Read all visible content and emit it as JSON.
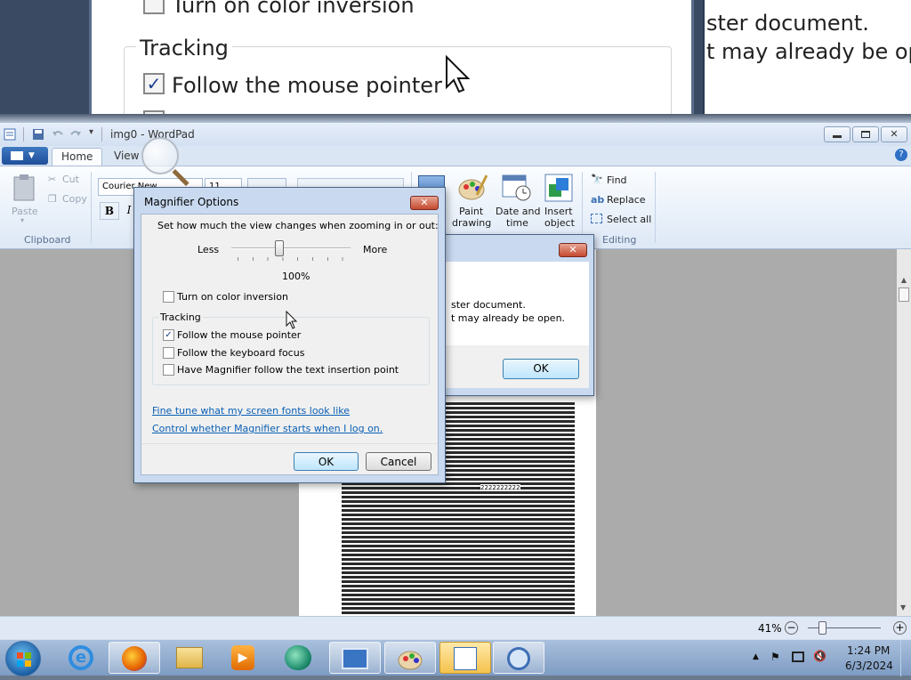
{
  "lens": {
    "color_inversion": "Turn on color inversion",
    "tracking": "Tracking",
    "follow_mouse": "Follow the mouse pointer",
    "line1": "ster document.",
    "line2": "t may already be ope"
  },
  "wordpad": {
    "title": "img0 - WordPad",
    "tabs": [
      "Home",
      "View"
    ],
    "clipboard": {
      "paste": "Paste",
      "cut": "Cut",
      "copy": "Copy",
      "group": "Clipboard"
    },
    "font": {
      "name": "Courier New",
      "size": "11",
      "bold": "B",
      "italic": "I"
    },
    "insert": {
      "paint": "Paint drawing",
      "datetime": "Date and time",
      "object": "Insert object"
    },
    "editing": {
      "find": "Find",
      "replace": "Replace",
      "select_all": "Select all",
      "group": "Editing"
    },
    "doc_marker": "2222222222",
    "zoom": "41%"
  },
  "message_dialog": {
    "line1": "ster document.",
    "line2": "t may already be open.",
    "ok": "OK"
  },
  "magnifier_options": {
    "title": "Magnifier Options",
    "close": "✕",
    "prompt": "Set how much the view changes when zooming in or out:",
    "less": "Less",
    "more": "More",
    "percent": "100%",
    "slider_level": 0.4,
    "color_inversion": "Turn on color inversion",
    "color_inversion_checked": false,
    "tracking": "Tracking",
    "follow_mouse": "Follow the mouse pointer",
    "follow_mouse_checked": true,
    "follow_keyboard": "Follow the keyboard focus",
    "follow_text": "Have Magnifier follow the text insertion point",
    "link_fonts": "Fine tune what my screen fonts look like",
    "link_logon": "Control whether Magnifier starts when I log on.",
    "ok": "OK",
    "cancel": "Cancel"
  },
  "taskbar": {
    "time": "1:24 PM",
    "date": "6/3/2024"
  }
}
